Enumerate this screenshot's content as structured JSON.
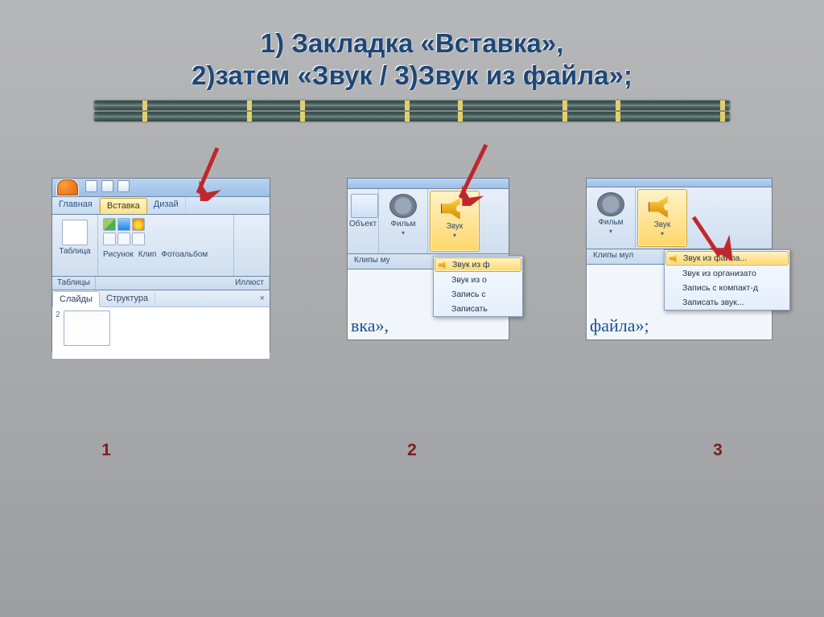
{
  "heading": {
    "line1": "1) Закладка «Вставка»,",
    "line2": "2)затем  «Звук / 3)Звук из файла»;"
  },
  "steps": {
    "n1": "1",
    "n2": "2",
    "n3": "3"
  },
  "shot1": {
    "tabs": {
      "home": "Главная",
      "insert": "Вставка",
      "design": "Дизай"
    },
    "ribbon": {
      "table": "Таблица",
      "picture": "Рисунок",
      "clip": "Клип",
      "photo": "Фотоальбом"
    },
    "group_labels": {
      "tables": "Таблицы",
      "illustr": "Иллюст"
    },
    "panetabs": {
      "slides": "Слайды",
      "outline": "Структура"
    },
    "slide_num": "2"
  },
  "shot2": {
    "ribbon": {
      "object": "Объект",
      "movie": "Фильм",
      "sound": "Звук"
    },
    "group_label": "Клипы му",
    "menu": {
      "m1": "Звук из ф",
      "m2": "Звук из о",
      "m3": "Запись с",
      "m4": "Записать"
    },
    "below": "вка»,"
  },
  "shot3": {
    "ribbon": {
      "movie": "Фильм",
      "sound": "Звук"
    },
    "group_label": "Клипы мул",
    "menu": {
      "m1": "Звук из файла...",
      "m2": "Звук из организато",
      "m3": "Запись с компакт-д",
      "m4": "Записать звук..."
    },
    "below": "файла»;"
  }
}
